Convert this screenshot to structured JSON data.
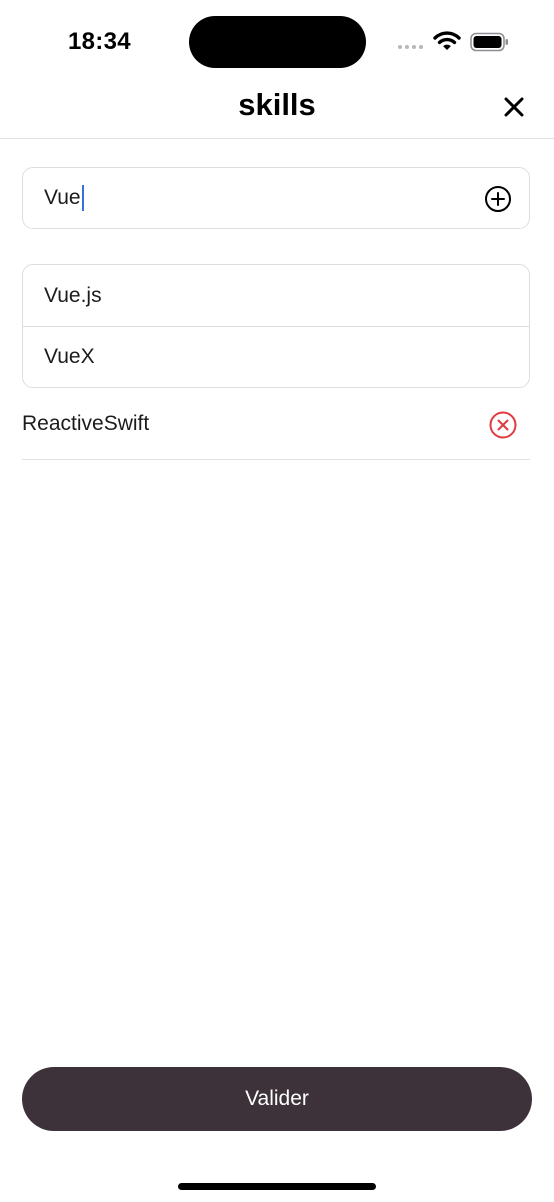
{
  "status_bar": {
    "time": "18:34"
  },
  "header": {
    "title": "skills",
    "close_icon": "close-icon"
  },
  "input": {
    "value": "Vue",
    "add_icon": "plus-circle-icon"
  },
  "suggestions": [
    {
      "label": "Vue.js"
    },
    {
      "label": "VueX"
    }
  ],
  "selected_skills": [
    {
      "label": "ReactiveSwift",
      "remove_icon": "x-circle-icon"
    }
  ],
  "footer": {
    "validate_label": "Valider"
  },
  "colors": {
    "accent_dark": "#3d3239",
    "remove_red": "#e0393e",
    "caret_blue": "#3a6fd9",
    "border": "#dedede"
  }
}
